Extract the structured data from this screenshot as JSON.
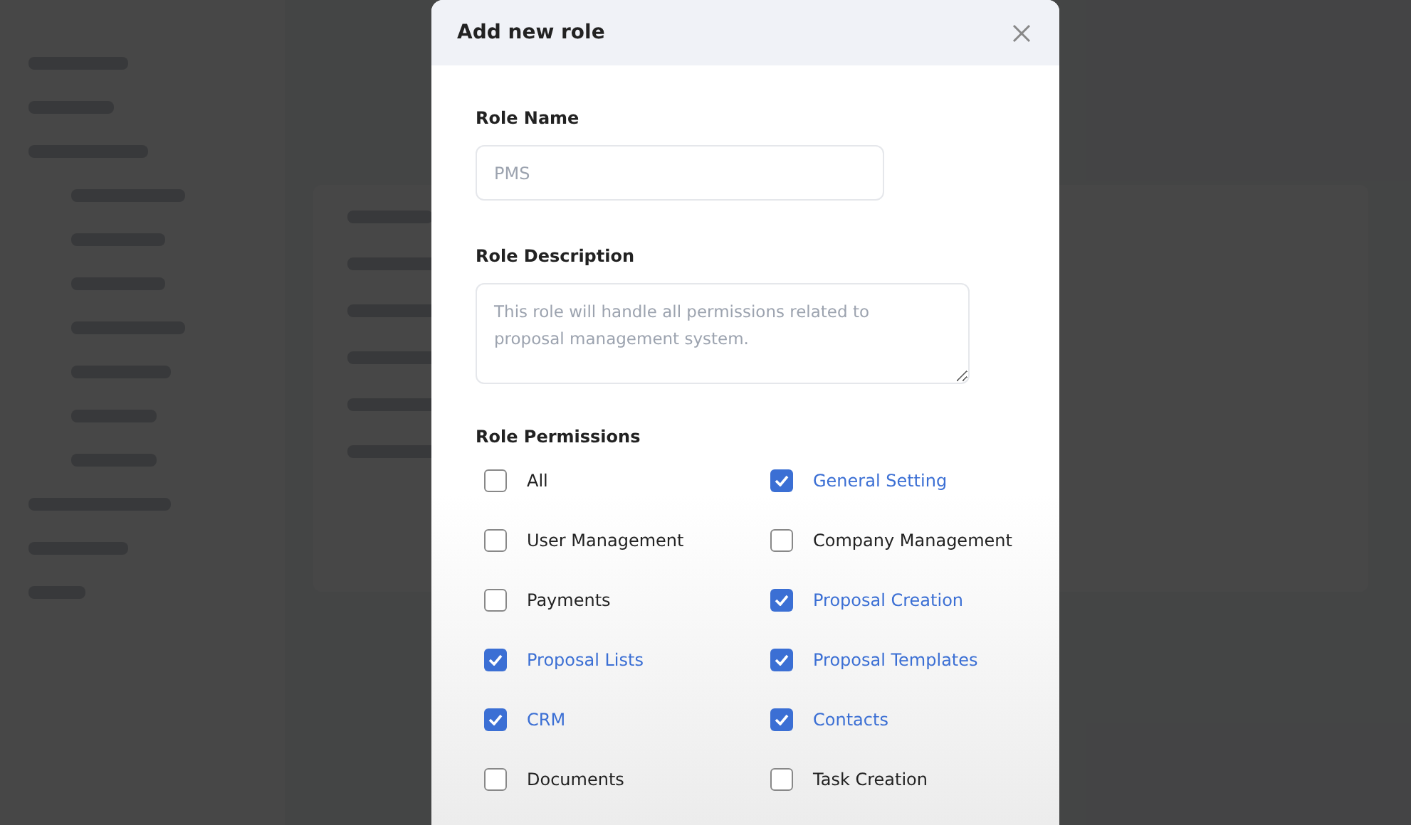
{
  "dialog": {
    "title": "Add new role",
    "role_name": {
      "label": "Role Name",
      "placeholder": "PMS"
    },
    "role_description": {
      "label": "Role Description",
      "placeholder": "This role will handle all permissions related to proposal management system."
    },
    "permissions_label": "Role Permissions",
    "permissions": [
      {
        "label": "All",
        "checked": false
      },
      {
        "label": "General Setting",
        "checked": true
      },
      {
        "label": "User Management",
        "checked": false
      },
      {
        "label": "Company Management",
        "checked": false
      },
      {
        "label": "Payments",
        "checked": false
      },
      {
        "label": "Proposal Creation",
        "checked": true
      },
      {
        "label": "Proposal Lists",
        "checked": true
      },
      {
        "label": "Proposal Templates",
        "checked": true
      },
      {
        "label": "CRM",
        "checked": true
      },
      {
        "label": "Contacts",
        "checked": true
      },
      {
        "label": "Documents",
        "checked": false
      },
      {
        "label": "Task Creation",
        "checked": false
      }
    ]
  }
}
